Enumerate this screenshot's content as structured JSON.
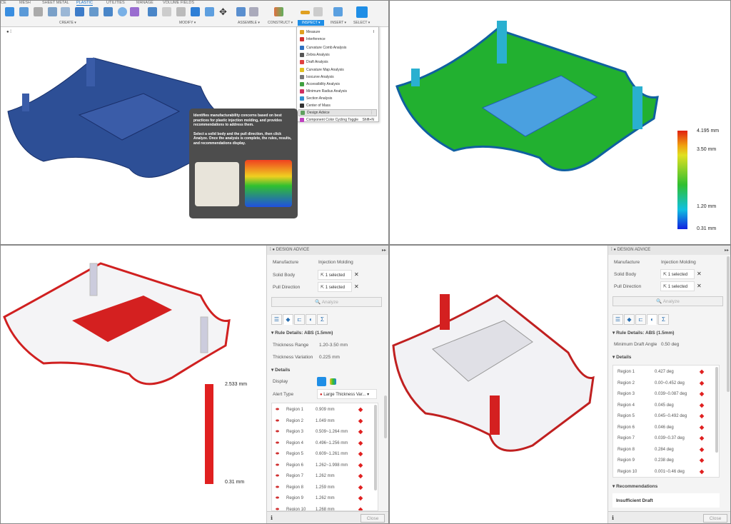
{
  "toolbar": {
    "tabs": [
      "CE",
      "MESH",
      "SHEET METAL",
      "PLASTIC",
      "UTILITIES",
      "MANAGE",
      "VOLUME FIELDS"
    ],
    "active_tab": "PLASTIC",
    "groups": [
      "CREATE ▾",
      "MODIFY ▾",
      "ASSEMBLE ▾",
      "CONSTRUCT ▾",
      "INSPECT ▾",
      "INSERT ▾",
      "SELECT ▾"
    ]
  },
  "inspect_menu": {
    "items": [
      {
        "label": "Measure",
        "shortcut": "I",
        "color": "#e0a020"
      },
      {
        "label": "Interference",
        "shortcut": "",
        "color": "#d03030"
      },
      {
        "label": "Curvature Comb Analysis",
        "shortcut": "",
        "color": "#3070c0"
      },
      {
        "label": "Zebra Analysis",
        "shortcut": "",
        "color": "#555555"
      },
      {
        "label": "Draft Analysis",
        "shortcut": "",
        "color": "#e04040"
      },
      {
        "label": "Curvature Map Analysis",
        "shortcut": "",
        "color": "#e0c020"
      },
      {
        "label": "Isocurve Analysis",
        "shortcut": "",
        "color": "#777777"
      },
      {
        "label": "Accessibility Analysis",
        "shortcut": "",
        "color": "#40a040"
      },
      {
        "label": "Minimum Radius Analysis",
        "shortcut": "",
        "color": "#d03060"
      },
      {
        "label": "Section Analysis",
        "shortcut": "",
        "color": "#3090d0"
      },
      {
        "label": "Center of Mass",
        "shortcut": "",
        "color": "#333333"
      },
      {
        "label": "Design Advice",
        "shortcut": "⋮",
        "color": "#60a060"
      },
      {
        "label": "Component Color Cycling Toggle",
        "shortcut": "Shift+N",
        "color": "#c040c0"
      }
    ],
    "highlighted": "Design Advice"
  },
  "tooltip": {
    "p1": "Identifies manufacturability concerns based on best practices for plastic injection molding, and provides recommendations to address them.",
    "p2": "Select a solid body and the pull direction, then click Analyze. Once the analysis is complete, the rules, results, and recommendations display."
  },
  "thickness_scale": {
    "labels": [
      "4.195 mm",
      "3.50 mm",
      "1.20 mm",
      "0.31 mm"
    ]
  },
  "variation_scale": {
    "labels": [
      "2.533 mm",
      "0.31 mm"
    ]
  },
  "panel_thickness": {
    "title": "DESIGN ADVICE",
    "manufacture_label": "Manufacture",
    "manufacture_value": "Injection Molding",
    "solid_body_label": "Solid Body",
    "pull_direction_label": "Pull Direction",
    "selected": "1 selected",
    "analyze": "Analyze",
    "rule_details": "Rule Details: ABS (1.5mm)",
    "thickness_range_label": "Thickness Range",
    "thickness_range": "1.20-3.50 mm",
    "thickness_variation_label": "Thickness Variation",
    "thickness_variation": "0.225 mm",
    "details": "Details",
    "display_label": "Display",
    "alert_type_label": "Alert Type",
    "alert_type": "Large Thickness Var...",
    "regions": [
      [
        "Region 1",
        "0.909 mm"
      ],
      [
        "Region 2",
        "1.049 mm"
      ],
      [
        "Region 3",
        "0.509~1.264 mm"
      ],
      [
        "Region 4",
        "0.496~1.256 mm"
      ],
      [
        "Region 5",
        "0.609~1.261 mm"
      ],
      [
        "Region 6",
        "1.262~1.998 mm"
      ],
      [
        "Region 7",
        "1.262 mm"
      ],
      [
        "Region 8",
        "1.259 mm"
      ],
      [
        "Region 9",
        "1.262 mm"
      ],
      [
        "Region 10",
        "1.268 mm"
      ]
    ],
    "close": "Close"
  },
  "panel_draft": {
    "title": "DESIGN ADVICE",
    "manufacture_label": "Manufacture",
    "manufacture_value": "Injection Molding",
    "solid_body_label": "Solid Body",
    "pull_direction_label": "Pull Direction",
    "selected": "1 selected",
    "analyze": "Analyze",
    "rule_details": "Rule Details: ABS (1.5mm)",
    "min_draft_label": "Minimum Draft Angle",
    "min_draft": "0.50 deg",
    "details": "Details",
    "regions": [
      [
        "Region 1",
        "0.427 deg"
      ],
      [
        "Region 2",
        "0.00~0.452 deg"
      ],
      [
        "Region 3",
        "0.039~0.087 deg"
      ],
      [
        "Region 4",
        "0.045 deg"
      ],
      [
        "Region 5",
        "0.045~0.492 deg"
      ],
      [
        "Region 6",
        "0.046 deg"
      ],
      [
        "Region 7",
        "0.039~0.37 deg"
      ],
      [
        "Region 8",
        "0.284 deg"
      ],
      [
        "Region 9",
        "0.238 deg"
      ],
      [
        "Region 10",
        "0.001~0.46 deg"
      ]
    ],
    "recommendations": "Recommendations",
    "recommendation_title": "Insufficient Draft",
    "close": "Close"
  }
}
